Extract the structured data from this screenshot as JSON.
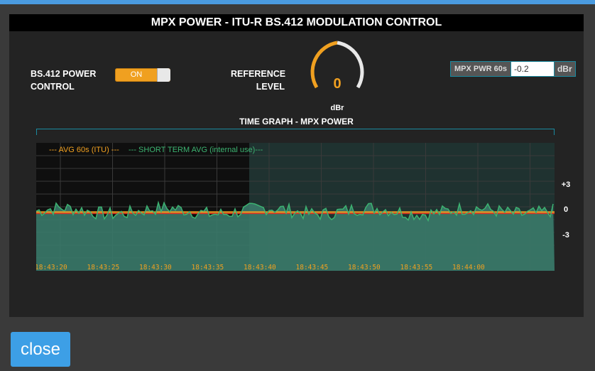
{
  "title": "MPX POWER - ITU-R BS.412 MODULATION CONTROL",
  "power_control": {
    "label_line1": "BS.412 POWER",
    "label_line2": "CONTROL",
    "toggle_label": "ON"
  },
  "reference": {
    "label_line1": "REFERENCE",
    "label_line2": "LEVEL",
    "value": "0",
    "unit": "dBr"
  },
  "mpx_readout": {
    "label": "MPX PWR 60s",
    "value": "-0.2",
    "unit": "dBr"
  },
  "graph": {
    "title": "TIME GRAPH - MPX POWER",
    "legend_avg": "--- AVG 60s (ITU) ---",
    "legend_short": "--- SHORT TERM AVG (internal use)---",
    "y_ticks": [
      "+3",
      "0",
      "-3"
    ],
    "x_ticks": [
      "18:43:20",
      "18:43:25",
      "18:43:30",
      "18:43:35",
      "18:43:40",
      "18:43:45",
      "18:43:50",
      "18:43:55",
      "18:44:00"
    ],
    "colors": {
      "avg": "#f0a020",
      "short": "#3cb371",
      "fill": "#3a7a6a",
      "avg_red": "#e03020"
    }
  },
  "close_label": "close"
}
